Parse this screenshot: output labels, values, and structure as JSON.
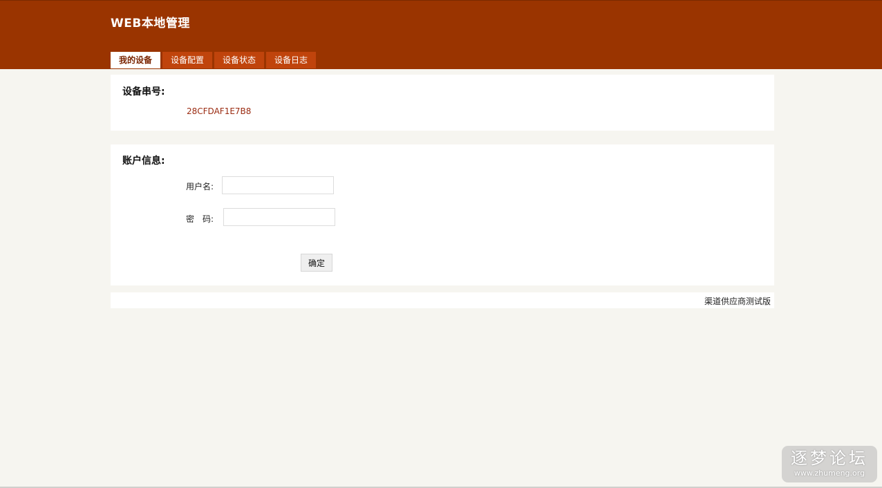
{
  "header": {
    "title": "WEB本地管理",
    "background_color": "#9a3400"
  },
  "tabs": [
    {
      "label": "我的设备",
      "active": true
    },
    {
      "label": "设备配置",
      "active": false
    },
    {
      "label": "设备状态",
      "active": false
    },
    {
      "label": "设备日志",
      "active": false
    }
  ],
  "serial_section": {
    "title": "设备串号:",
    "value": "28CFDAF1E7B8"
  },
  "account_section": {
    "title": "账户信息:",
    "username_label": "用户名:",
    "username_value": "",
    "password_label": "密　码:",
    "password_value": "",
    "confirm_label": "确定"
  },
  "footer": {
    "text": "渠道供应商测试版"
  },
  "watermark": {
    "main": "逐梦论坛",
    "url": "www.zhumeng.org"
  }
}
